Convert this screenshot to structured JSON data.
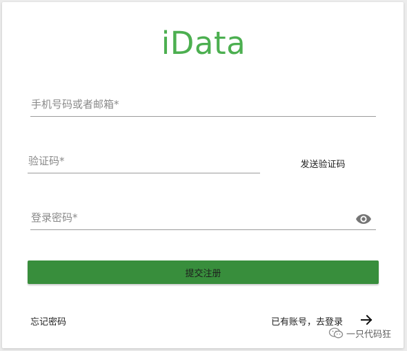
{
  "logo": {
    "text": "iData"
  },
  "form": {
    "account_placeholder": "手机号码或者邮箱*",
    "code_placeholder": "验证码*",
    "send_code_label": "发送验证码",
    "password_placeholder": "登录密码*",
    "password_toggle_icon": "eye-icon",
    "submit_label": "提交注册"
  },
  "links": {
    "forgot_password": "忘记密码",
    "have_account": "已有账号，去登录",
    "arrow_icon": "arrow-right-icon"
  },
  "watermark": {
    "text": "一只代码狂",
    "icon": "wechat-icon"
  },
  "colors": {
    "brand": "#4caf50",
    "button": "#388e3c"
  }
}
